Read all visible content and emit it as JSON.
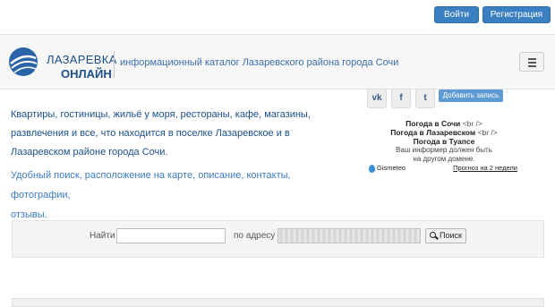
{
  "auth": {
    "login_label": "Войти",
    "register_label": "Регистрация"
  },
  "brand": {
    "name_line1": "ЛАЗАРЕВКА",
    "name_line2": "ОНЛАЙН",
    "tagline": "информационный каталог Лазаревского района города Сочи"
  },
  "colors": {
    "accent": "#3a7fc1",
    "brand": "#1d4f8a",
    "link": "#3c7cc2"
  },
  "social": [
    {
      "name": "vk-icon",
      "glyph": "vk"
    },
    {
      "name": "facebook-icon",
      "glyph": "f"
    },
    {
      "name": "twitter-icon",
      "glyph": "t"
    }
  ],
  "add_listing_label": "Добавить запись",
  "hero": {
    "line1": "Квартиры, гостиницы, жильё у моря, рестораны, кафе, магазины,",
    "line2": "развлечения и все, что находится в поселке Лазаревское и в",
    "line3": "Лазаревском районе города Сочи.",
    "sub1": "Удобный поиск, расположение на карте, описание, контакты, фотографии,",
    "sub2": "отзывы."
  },
  "weather": {
    "line1": "Погода в Сочи",
    "line2": "Погода в Лазаревском",
    "line3": "Погода в Туапсе",
    "br_tag": "<br />",
    "note1": "Ваш информер должен быть",
    "note2": "на другом домене.",
    "provider": "Gismeteo",
    "forecast_link": "Прогноз на 2 недели"
  },
  "search": {
    "find_label": "Найти",
    "find_value": "",
    "address_label": "по адресу",
    "button_label": "Поиск"
  }
}
